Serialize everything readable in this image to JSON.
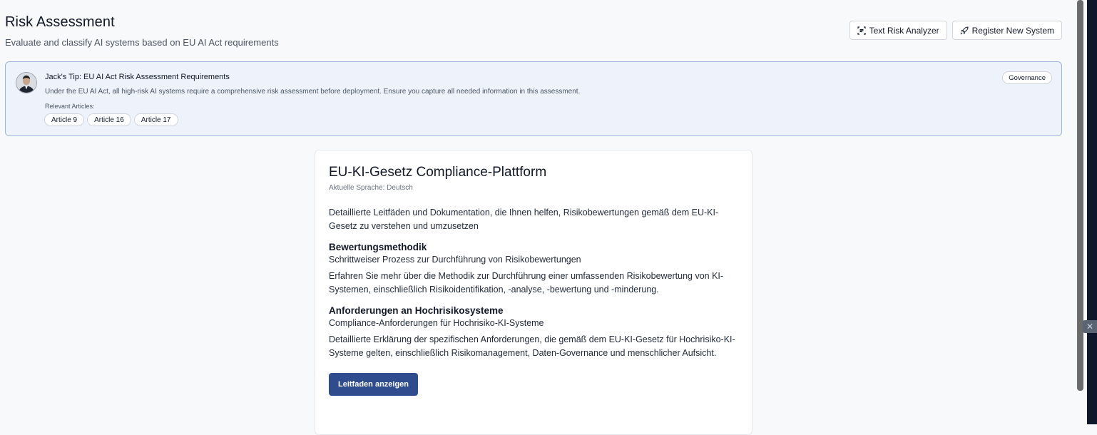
{
  "header": {
    "title": "Risk Assessment",
    "subtitle": "Evaluate and classify AI systems based on EU AI Act requirements"
  },
  "actions": {
    "text_risk_analyzer": "Text Risk Analyzer",
    "register_new_system": "Register New System"
  },
  "tip": {
    "title": "Jack's Tip: EU AI Act Risk Assessment Requirements",
    "text": "Under the EU AI Act, all high-risk AI systems require a comprehensive risk assessment before deployment. Ensure you capture all needed information in this assessment.",
    "relevant_label": "Relevant Articles:",
    "articles": [
      "Article 9",
      "Article 16",
      "Article 17"
    ],
    "badge": "Governance"
  },
  "card": {
    "title": "EU-KI-Gesetz Compliance-Plattform",
    "language": "Aktuelle Sprache: Deutsch",
    "intro": "Detaillierte Leitfäden und Dokumentation, die Ihnen helfen, Risikobewertungen gemäß dem EU-KI-Gesetz zu verstehen und umzusetzen",
    "sections": [
      {
        "heading": "Bewertungsmethodik",
        "subheading": "Schrittweiser Prozess zur Durchführung von Risikobewertungen",
        "body": "Erfahren Sie mehr über die Methodik zur Durchführung einer umfassenden Risikobewertung von KI-Systemen, einschließlich Risikoidentifikation, -analyse, -bewertung und -minderung."
      },
      {
        "heading": "Anforderungen an Hochrisikosysteme",
        "subheading": "Compliance-Anforderungen für Hochrisiko-KI-Systeme",
        "body": "Detaillierte Erklärung der spezifischen Anforderungen, die gemäß dem EU-KI-Gesetz für Hochrisiko-KI-Systeme gelten, einschließlich Risikomanagement, Daten-Governance und menschlicher Aufsicht."
      }
    ],
    "button": "Leitfaden anzeigen"
  },
  "icons": {
    "scan": "scan-text-icon",
    "rocket": "rocket-icon",
    "close": "close-icon"
  },
  "colors": {
    "primary": "#2f4d8e",
    "tip_border": "#9fb4dc",
    "tip_bg": "#eef2fb"
  }
}
